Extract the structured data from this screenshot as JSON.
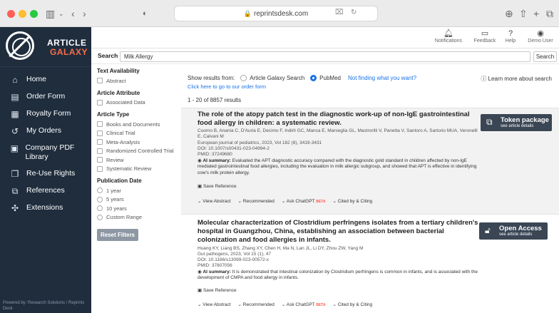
{
  "browser": {
    "url": "reprintsdesk.com"
  },
  "logo": {
    "line1": "ARTICLE",
    "line2": "GALAXY"
  },
  "sidebar": {
    "items": [
      {
        "label": "Home",
        "icon": "home-icon"
      },
      {
        "label": "Order Form",
        "icon": "document-icon"
      },
      {
        "label": "Royalty Form",
        "icon": "royalty-icon"
      },
      {
        "label": "My Orders",
        "icon": "history-icon"
      },
      {
        "label": "Company PDF Library",
        "icon": "library-icon"
      },
      {
        "label": "Re-Use Rights",
        "icon": "copy-icon"
      },
      {
        "label": "References",
        "icon": "references-icon"
      },
      {
        "label": "Extensions",
        "icon": "puzzle-icon"
      }
    ],
    "powered": "Powered by: Research Solutions / Reprints Desk"
  },
  "topbar": {
    "notifications": "Notifications",
    "feedback": "Feedback",
    "help": "Help",
    "user": "Demo User"
  },
  "search": {
    "label": "Search",
    "value": "Milk Allergy",
    "button": "Search"
  },
  "filters": {
    "text_availability": {
      "title": "Text Availability",
      "options": [
        "Abstract"
      ]
    },
    "article_attribute": {
      "title": "Article Attribute",
      "options": [
        "Associated Data"
      ]
    },
    "article_type": {
      "title": "Article Type",
      "options": [
        "Books and Documents",
        "Clinical Trial",
        "Meta-Analysis",
        "Randomized Controlled Trial",
        "Review",
        "Systematic Review"
      ]
    },
    "publication_date": {
      "title": "Publication Date",
      "options": [
        "1 year",
        "5 years",
        "10 years",
        "Custom Range"
      ]
    },
    "reset": "Reset Filters"
  },
  "results": {
    "show_from": "Show results from:",
    "source_galaxy": "Article Galaxy Search",
    "source_pubmed": "PubMed",
    "not_finding": "Not finding what you want?",
    "order_link": "Click here to go to our order form",
    "learn_more": "Learn more about search",
    "count": "1 - 20 of 8857 results",
    "items": [
      {
        "title": "The role of the atopy patch test in the diagnostic work-up of non-IgE gastrointestinal food allergy in children: a systematic review.",
        "authors": "Cuomo B, Anania C, D'Auria E, Decimo F, Indirli GC, Manca E, Marseglia GL, Mastrorilli V, Panetta V, Santoro A, Sartorio MUA, Veronelli E, Calvani M",
        "journal": "European journal of pediatrics, 2023, Vol 182 (8), 3419-3431",
        "doi": "DOI: 10.1007/s00431-023-04994-2",
        "pmid": "PMID: 37249680",
        "summary_label": "AI summary:",
        "summary": "Evaluated the APT diagnostic accuracy compared with the diagnostic gold standard in children affected by non-IgE mediated gastrointestinal food allergies, including the evaluation in milk allergic subgroup, and showed that APT is effective in identifying cow's milk protein allergy.",
        "save": "Save Reference",
        "badge_title": "Token package",
        "badge_sub": "see article details"
      },
      {
        "title": "Molecular characterization of Clostridium perfringens isolates from a tertiary children's hospital in Guangzhou, China, establishing an association between bacterial colonization and food allergies in infants.",
        "authors": "Huang KY, Liang BS, Zhang XY, Chen H, Ma N, Lan JL, Li DY, Zhou ZW, Yang M",
        "journal": "Gut pathogens, 2023, Vol 15 (1), 47",
        "doi": "DOI: 10.1186/s13099-023-00572-x",
        "pmid": "PMID: 37807056",
        "summary_label": "AI summary:",
        "summary": "It is demonstrated that intestinal colonization by Clostridium perfringens is common in infants, and is associated with the development of CMPA and food allergy in infants.",
        "save": "Save Reference",
        "badge_title": "Open Access",
        "badge_sub": "see article details"
      }
    ],
    "actions": {
      "abstract": "View Abstract",
      "recommended": "Recommended",
      "chatgpt": "Ask ChatGPT",
      "beta": "BETA",
      "cited": "Cited by & Citing"
    }
  }
}
